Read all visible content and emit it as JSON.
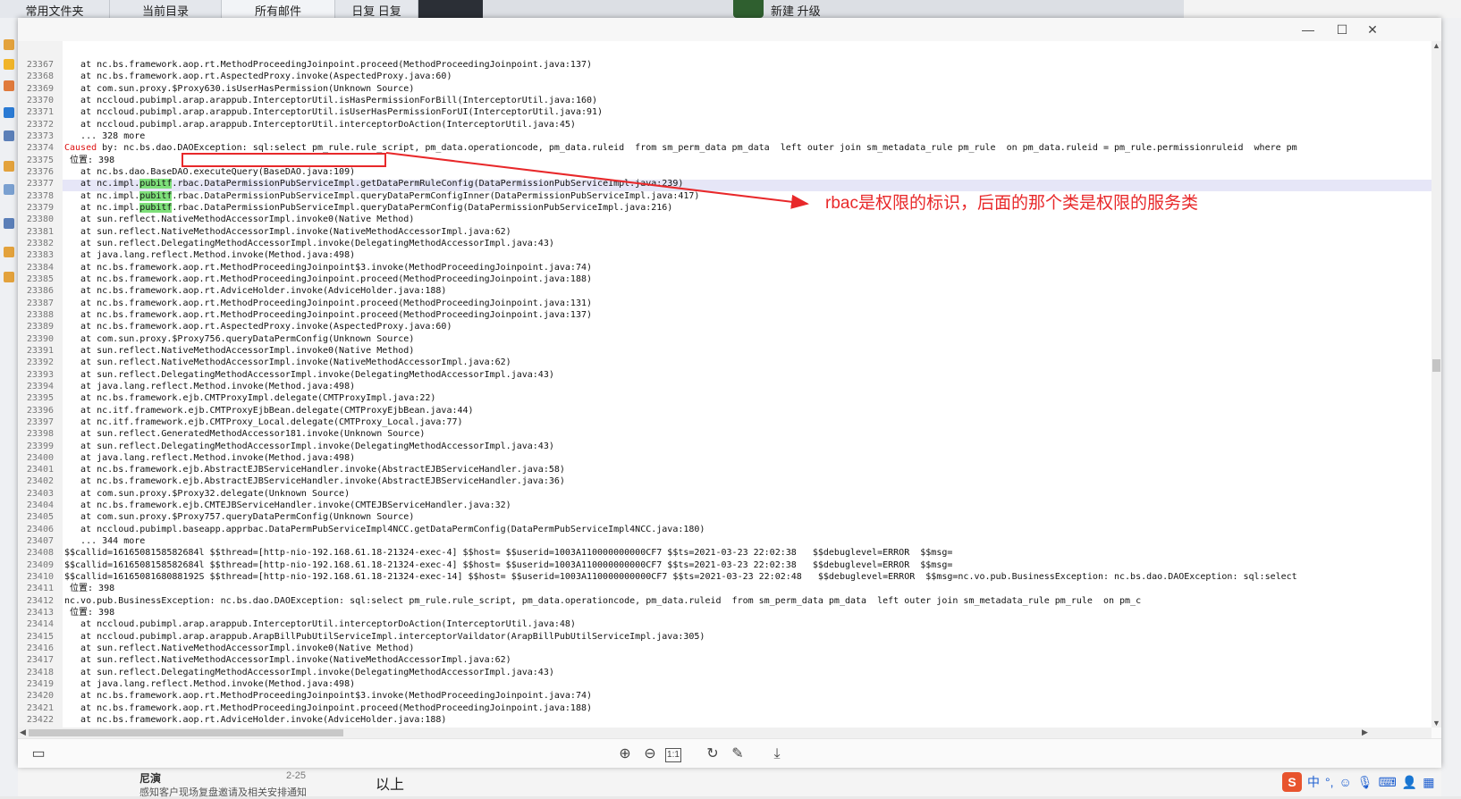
{
  "background": {
    "tabs": [
      "常用文件夹",
      "当前目录",
      "所有邮件",
      "日复 日复"
    ],
    "top_right_text": "新建 升级",
    "bottom_item_title": "尼演",
    "bottom_item_date": "2-25",
    "bottom_item_preview": "感知客户现场复盘邀请及相关安排通知",
    "bottom_item_right": "以上"
  },
  "viewer": {
    "window_controls": [
      "—",
      "☐",
      "✕"
    ],
    "lines": [
      {
        "n": "23367",
        "t": "   at nc.bs.framework.aop.rt.MethodProceedingJoinpoint.proceed(MethodProceedingJoinpoint.java:137)"
      },
      {
        "n": "23368",
        "t": "   at nc.bs.framework.aop.rt.AspectedProxy.invoke(AspectedProxy.java:60)"
      },
      {
        "n": "23369",
        "t": "   at com.sun.proxy.$Proxy630.isUserHasPermission(Unknown Source)"
      },
      {
        "n": "23370",
        "t": "   at nccloud.pubimpl.arap.arappub.InterceptorUtil.isHasPermissionForBill(InterceptorUtil.java:160)"
      },
      {
        "n": "23371",
        "t": "   at nccloud.pubimpl.arap.arappub.InterceptorUtil.isUserHasPermissionForUI(InterceptorUtil.java:91)"
      },
      {
        "n": "23372",
        "t": "   at nccloud.pubimpl.arap.arappub.InterceptorUtil.interceptorDoAction(InterceptorUtil.java:45)"
      },
      {
        "n": "23373",
        "t": "   ... 328 more"
      },
      {
        "n": "23374",
        "p": "Caused",
        "t": " by: nc.bs.dao.DAOException: sql:select pm_rule.rule_script, pm_data.operationcode, pm_data.ruleid  from sm_perm_data pm_data  left outer join sm_metadata_rule pm_rule  on pm_data.ruleid = pm_rule.permissionruleid  where pm"
      },
      {
        "n": "23375",
        "t": " 位置: 398"
      },
      {
        "n": "23376",
        "t": "   at nc.bs.dao.BaseDAO.executeQuery(BaseDAO.java:109)"
      },
      {
        "n": "23377",
        "p": "   at nc.impl.",
        "g": "pubitf",
        "t": ".rbac.DataPermissionPubServiceImpl.getDataPermRuleConfig(DataPermissionPubServiceImpl.java:239)"
      },
      {
        "n": "23378",
        "p": "   at nc.impl.",
        "g": "pubitf",
        "t": ".rbac.DataPermissionPubServiceImpl.queryDataPermConfigInner(DataPermissionPubServiceImpl.java:417)"
      },
      {
        "n": "23379",
        "p": "   at nc.impl.",
        "g": "pubitf",
        "t": ".rbac.DataPermissionPubServiceImpl.queryDataPermConfig(DataPermissionPubServiceImpl.java:216)"
      },
      {
        "n": "23380",
        "t": "   at sun.reflect.NativeMethodAccessorImpl.invoke0(Native Method)"
      },
      {
        "n": "23381",
        "t": "   at sun.reflect.NativeMethodAccessorImpl.invoke(NativeMethodAccessorImpl.java:62)"
      },
      {
        "n": "23382",
        "t": "   at sun.reflect.DelegatingMethodAccessorImpl.invoke(DelegatingMethodAccessorImpl.java:43)"
      },
      {
        "n": "23383",
        "t": "   at java.lang.reflect.Method.invoke(Method.java:498)"
      },
      {
        "n": "23384",
        "t": "   at nc.bs.framework.aop.rt.MethodProceedingJoinpoint$3.invoke(MethodProceedingJoinpoint.java:74)"
      },
      {
        "n": "23385",
        "t": "   at nc.bs.framework.aop.rt.MethodProceedingJoinpoint.proceed(MethodProceedingJoinpoint.java:188)"
      },
      {
        "n": "23386",
        "t": "   at nc.bs.framework.aop.rt.AdviceHolder.invoke(AdviceHolder.java:188)"
      },
      {
        "n": "23387",
        "t": "   at nc.bs.framework.aop.rt.MethodProceedingJoinpoint.proceed(MethodProceedingJoinpoint.java:131)"
      },
      {
        "n": "23388",
        "t": "   at nc.bs.framework.aop.rt.MethodProceedingJoinpoint.proceed(MethodProceedingJoinpoint.java:137)"
      },
      {
        "n": "23389",
        "t": "   at nc.bs.framework.aop.rt.AspectedProxy.invoke(AspectedProxy.java:60)"
      },
      {
        "n": "23390",
        "t": "   at com.sun.proxy.$Proxy756.queryDataPermConfig(Unknown Source)"
      },
      {
        "n": "23391",
        "t": "   at sun.reflect.NativeMethodAccessorImpl.invoke0(Native Method)"
      },
      {
        "n": "23392",
        "t": "   at sun.reflect.NativeMethodAccessorImpl.invoke(NativeMethodAccessorImpl.java:62)"
      },
      {
        "n": "23393",
        "t": "   at sun.reflect.DelegatingMethodAccessorImpl.invoke(DelegatingMethodAccessorImpl.java:43)"
      },
      {
        "n": "23394",
        "t": "   at java.lang.reflect.Method.invoke(Method.java:498)"
      },
      {
        "n": "23395",
        "t": "   at nc.bs.framework.ejb.CMTProxyImpl.delegate(CMTProxyImpl.java:22)"
      },
      {
        "n": "23396",
        "t": "   at nc.itf.framework.ejb.CMTProxyEjbBean.delegate(CMTProxyEjbBean.java:44)"
      },
      {
        "n": "23397",
        "t": "   at nc.itf.framework.ejb.CMTProxy_Local.delegate(CMTProxy_Local.java:77)"
      },
      {
        "n": "23398",
        "t": "   at sun.reflect.GeneratedMethodAccessor181.invoke(Unknown Source)"
      },
      {
        "n": "23399",
        "t": "   at sun.reflect.DelegatingMethodAccessorImpl.invoke(DelegatingMethodAccessorImpl.java:43)"
      },
      {
        "n": "23400",
        "t": "   at java.lang.reflect.Method.invoke(Method.java:498)"
      },
      {
        "n": "23401",
        "t": "   at nc.bs.framework.ejb.AbstractEJBServiceHandler.invoke(AbstractEJBServiceHandler.java:58)"
      },
      {
        "n": "23402",
        "t": "   at nc.bs.framework.ejb.AbstractEJBServiceHandler.invoke(AbstractEJBServiceHandler.java:36)"
      },
      {
        "n": "23403",
        "t": "   at com.sun.proxy.$Proxy32.delegate(Unknown Source)"
      },
      {
        "n": "23404",
        "t": "   at nc.bs.framework.ejb.CMTEJBServiceHandler.invoke(CMTEJBServiceHandler.java:32)"
      },
      {
        "n": "23405",
        "t": "   at com.sun.proxy.$Proxy757.queryDataPermConfig(Unknown Source)"
      },
      {
        "n": "23406",
        "t": "   at nccloud.pubimpl.baseapp.apprbac.DataPermPubServiceImpl4NCC.getDataPermConfig(DataPermPubServiceImpl4NCC.java:180)"
      },
      {
        "n": "23407",
        "t": "   ... 344 more"
      },
      {
        "n": "23408",
        "t": "$$callid=1616508158582684l $$thread=[http-nio-192.168.61.18-21324-exec-4] $$host= $$userid=1003A110000000000CF7 $$ts=2021-03-23 22:02:38   $$debuglevel=ERROR  $$msg="
      },
      {
        "n": "23409",
        "t": "$$callid=1616508158582684l $$thread=[http-nio-192.168.61.18-21324-exec-4] $$host= $$userid=1003A110000000000CF7 $$ts=2021-03-23 22:02:38   $$debuglevel=ERROR  $$msg="
      },
      {
        "n": "23410",
        "t": "$$callid=1616508168088192S $$thread=[http-nio-192.168.61.18-21324-exec-14] $$host= $$userid=1003A110000000000CF7 $$ts=2021-03-23 22:02:48   $$debuglevel=ERROR  $$msg=nc.vo.pub.BusinessException: nc.bs.dao.DAOException: sql:select"
      },
      {
        "n": "23411",
        "t": " 位置: 398"
      },
      {
        "n": "23412",
        "t": "nc.vo.pub.BusinessException: nc.bs.dao.DAOException: sql:select pm_rule.rule_script, pm_data.operationcode, pm_data.ruleid  from sm_perm_data pm_data  left outer join sm_metadata_rule pm_rule  on pm_c"
      },
      {
        "n": "23413",
        "t": " 位置: 398"
      },
      {
        "n": "23414",
        "t": "   at nccloud.pubimpl.arap.arappub.InterceptorUtil.interceptorDoAction(InterceptorUtil.java:48)"
      },
      {
        "n": "23415",
        "t": "   at nccloud.pubimpl.arap.arappub.ArapBillPubUtilServiceImpl.interceptorVaildator(ArapBillPubUtilServiceImpl.java:305)"
      },
      {
        "n": "23416",
        "t": "   at sun.reflect.NativeMethodAccessorImpl.invoke0(Native Method)"
      },
      {
        "n": "23417",
        "t": "   at sun.reflect.NativeMethodAccessorImpl.invoke(NativeMethodAccessorImpl.java:62)"
      },
      {
        "n": "23418",
        "t": "   at sun.reflect.DelegatingMethodAccessorImpl.invoke(DelegatingMethodAccessorImpl.java:43)"
      },
      {
        "n": "23419",
        "t": "   at java.lang.reflect.Method.invoke(Method.java:498)"
      },
      {
        "n": "23420",
        "t": "   at nc.bs.framework.aop.rt.MethodProceedingJoinpoint$3.invoke(MethodProceedingJoinpoint.java:74)"
      },
      {
        "n": "23421",
        "t": "   at nc.bs.framework.aop.rt.MethodProceedingJoinpoint.proceed(MethodProceedingJoinpoint.java:188)"
      },
      {
        "n": "23422",
        "t": "   at nc.bs.framework.aop.rt.AdviceHolder.invoke(AdviceHolder.java:188)"
      }
    ],
    "highlighted_line": "23377",
    "toolbar_icons": [
      "sidebar-toggle-icon",
      "zoom-in-icon",
      "zoom-out-icon",
      "actual-size-icon",
      "rotate-icon",
      "edit-icon",
      "download-icon"
    ]
  },
  "annotation": {
    "text": "rbac是权限的标识，后面的那个类是权限的服务类",
    "color": "#e8282a"
  },
  "ime": {
    "label": "中",
    "extra": "°,"
  }
}
